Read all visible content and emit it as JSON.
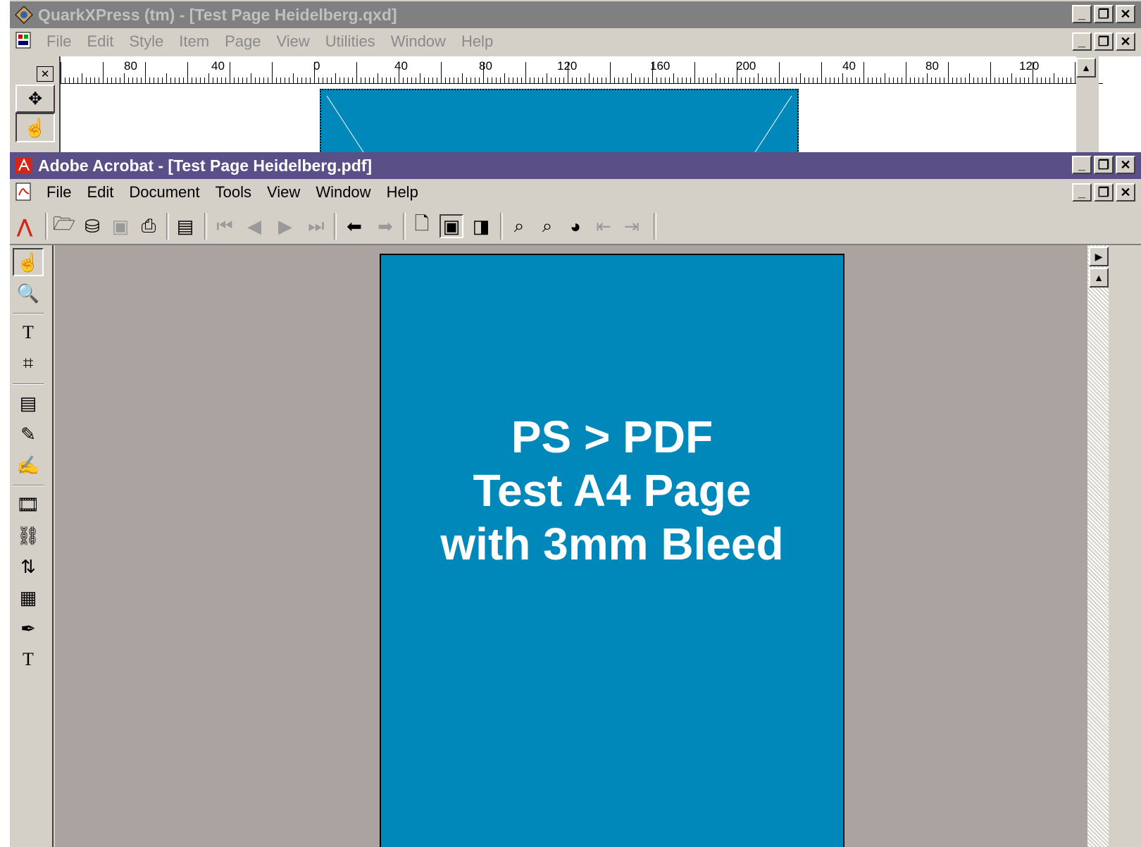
{
  "quark": {
    "title": "QuarkXPress (tm) - [Test Page Heidelberg.qxd]",
    "menu": [
      "File",
      "Edit",
      "Style",
      "Item",
      "Page",
      "View",
      "Utilities",
      "Window",
      "Help"
    ],
    "ruler_labels": [
      "80",
      "40",
      "0",
      "40",
      "80",
      "120",
      "160",
      "200",
      "40",
      "80",
      "120"
    ],
    "page_color": "#0088bb"
  },
  "acrobat": {
    "title": "Adobe Acrobat - [Test Page Heidelberg.pdf]",
    "menu": [
      "File",
      "Edit",
      "Document",
      "Tools",
      "View",
      "Window",
      "Help"
    ],
    "titlebar_color": "#5a4f86",
    "page": {
      "line1": "PS > PDF",
      "line2": "Test A4 Page",
      "line3": "with 3mm Bleed",
      "color": "#0088bb"
    }
  },
  "window_controls": {
    "minimize": "_",
    "restore": "❐",
    "close": "✕"
  }
}
